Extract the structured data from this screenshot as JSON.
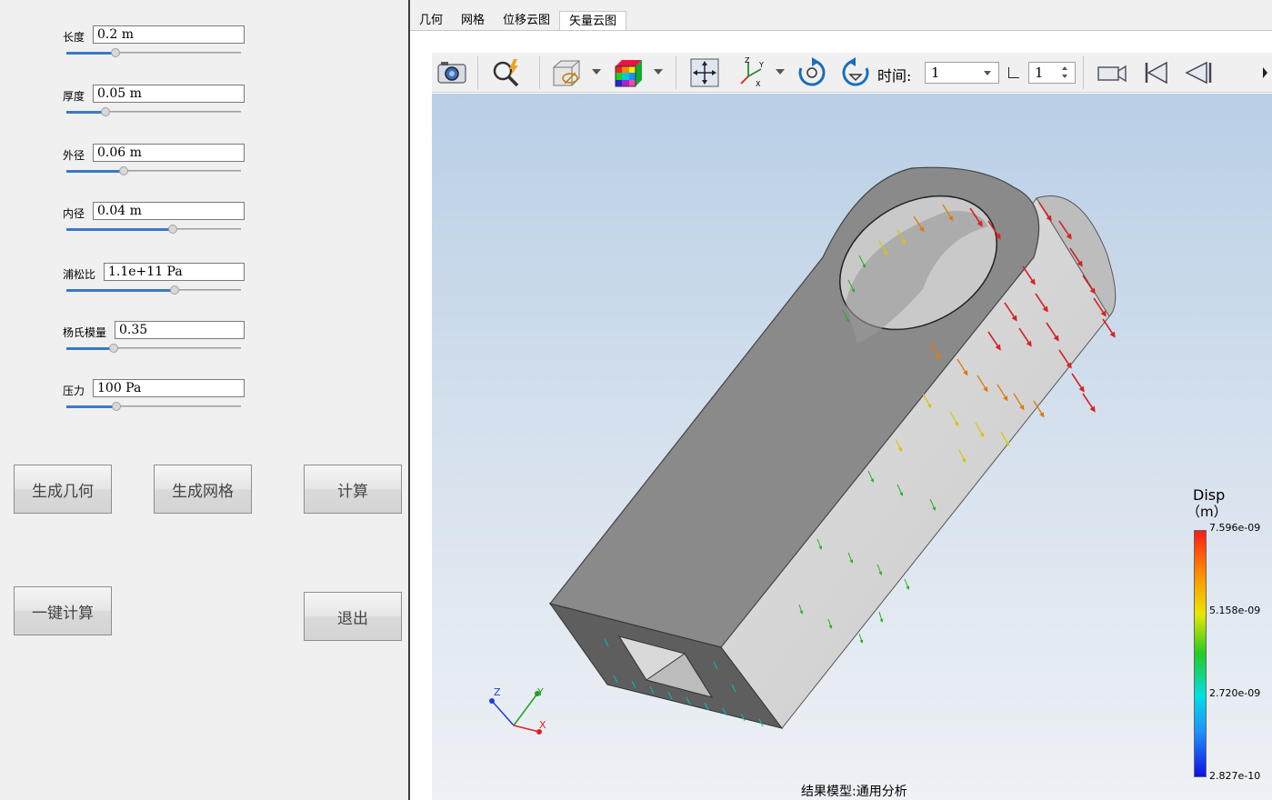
{
  "params": [
    {
      "label": "长度",
      "value": "0.2 m",
      "slider": 0.27
    },
    {
      "label": "厚度",
      "value": "0.05 m",
      "slider": 0.22
    },
    {
      "label": "外径",
      "value": "0.06 m",
      "slider": 0.33
    },
    {
      "label": "内径",
      "value": "0.04 m",
      "slider": 0.6
    },
    {
      "label": "浦松比",
      "value": "1.1e+11 Pa",
      "slider": 0.62
    },
    {
      "label": "杨氏模量",
      "value": "0.35",
      "slider": 0.27
    },
    {
      "label": "压力",
      "value": "100 Pa",
      "slider": 0.28
    }
  ],
  "buttons": {
    "gen_geometry": "生成几何",
    "gen_mesh": "生成网格",
    "compute": "计算",
    "one_click": "一键计算",
    "exit": "退出"
  },
  "tabs": [
    "几何",
    "网格",
    "位移云图",
    "矢量云图"
  ],
  "active_tab": "矢量云图",
  "toolbar": {
    "time_label": "时间:",
    "time_value": "1",
    "step_value": "1",
    "icons": [
      "camera-icon",
      "zoom-icon",
      "display-mode-icon",
      "color-map-icon",
      "fit-view-icon",
      "axes-icon",
      "rotate-cw-icon",
      "rotate-ccw-icon",
      "video-icon",
      "first-frame-icon",
      "prev-frame-icon"
    ]
  },
  "legend": {
    "title": "Disp",
    "unit": "（m）",
    "max": "7.596e-09",
    "v2": "5.158e-09",
    "v3": "2.720e-09",
    "min": "2.827e-10"
  },
  "viewport": {
    "caption": "结果模型:通用分析",
    "axis_x": "X",
    "axis_y": "Y",
    "axis_z": "Z"
  },
  "colors": {
    "accent": "#3b79c8",
    "model_gray": "#8a8a8a"
  }
}
